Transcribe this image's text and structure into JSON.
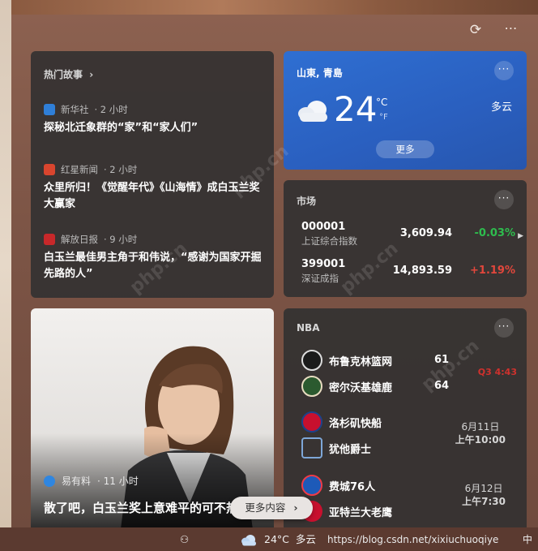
{
  "panel": {
    "refresh_icon": "refresh-icon",
    "more_icon": "more-icon",
    "more_glyph": "⋯"
  },
  "top_stories": {
    "title": "热门故事",
    "chevron": "›",
    "items": [
      {
        "source": "新华社",
        "time": "· 2 小时",
        "title": "探秘北迁象群的“家”和“家人们”",
        "icon_color": "#2f7fd8"
      },
      {
        "source": "红星新闻",
        "time": "· 2 小时",
        "title": "众里所归！《觉醒年代》《山海情》成白玉兰奖大赢家",
        "icon_color": "#d9452e"
      },
      {
        "source": "解放日报",
        "time": "· 9 小时",
        "title": "白玉兰最佳男主角于和伟说，“感谢为国家开掘先路的人”",
        "icon_color": "#c8282a"
      }
    ]
  },
  "weather": {
    "location": "山東, 青島",
    "temp": "24",
    "unit_c": "°C",
    "unit_f": "°F",
    "condition": "多云",
    "more": "更多",
    "card_more": "···",
    "bg": "#2a5fbf"
  },
  "market": {
    "title": "市场",
    "card_more": "···",
    "arrow": "▶",
    "stocks": [
      {
        "code": "000001",
        "name": "上证综合指数",
        "price": "3,609.94",
        "change": "-0.03%",
        "color": "#2ebd4e"
      },
      {
        "code": "399001",
        "name": "深证成指",
        "price": "14,893.59",
        "change": "+1.19%",
        "color": "#e2473c"
      }
    ]
  },
  "photo_news": {
    "source": "易有料",
    "time": "· 11 小时",
    "title": "散了吧，白玉兰奖上意难平的可不热依扎"
  },
  "nba": {
    "title": "NBA",
    "card_more": "···",
    "games": [
      {
        "home": "布鲁克林篮网",
        "home_score": "61",
        "away": "密尔沃基雄鹿",
        "away_score": "64",
        "status": "Q3 4:43"
      },
      {
        "home": "洛杉矶快船",
        "away": "犹他爵士",
        "date": "6月11日",
        "time": "上午10:00"
      },
      {
        "home": "费城76人",
        "away": "亚特兰大老鹰",
        "date": "6月12日",
        "time": "上午7:30"
      }
    ]
  },
  "more_content": {
    "label": "更多内容",
    "chevron": "›"
  },
  "taskbar": {
    "weather_temp": "24°C",
    "weather_cond": "多云",
    "url_text": "https://blog.csdn.net/xixiuchuoqiye",
    "ime": "中"
  }
}
